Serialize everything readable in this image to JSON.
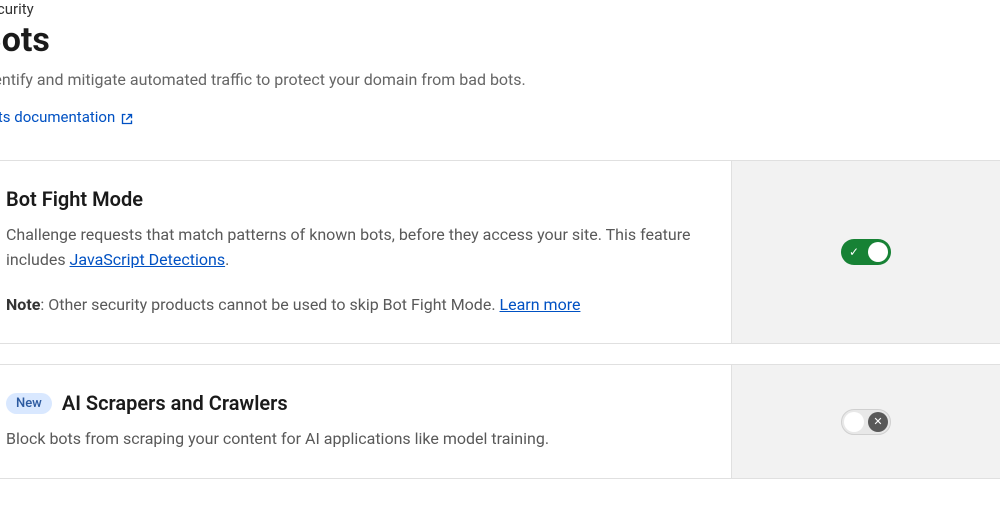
{
  "breadcrumb": "Security",
  "title": "Bots",
  "subtitle": "Identify and mitigate automated traffic to protect your domain from bad bots.",
  "doc_link_text": "Bots documentation",
  "cards": {
    "bot_fight": {
      "title": "Bot Fight Mode",
      "desc_before": "Challenge requests that match patterns of known bots, before they access your site. This feature includes ",
      "desc_link": "JavaScript Detections",
      "desc_after": ".",
      "note_label": "Note",
      "note_text": ": Other security products cannot be used to skip Bot Fight Mode. ",
      "note_link": "Learn more",
      "toggle_state": "on"
    },
    "ai_scrapers": {
      "badge": "New",
      "title": "AI Scrapers and Crawlers",
      "desc": "Block bots from scraping your content for AI applications like model training.",
      "toggle_state": "off"
    }
  }
}
